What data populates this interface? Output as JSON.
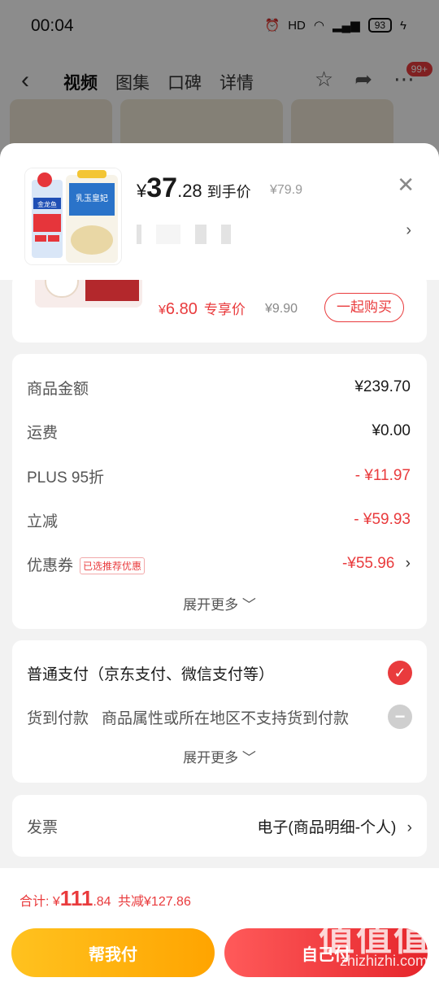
{
  "status_bar": {
    "time": "00:04",
    "battery": "93"
  },
  "nav": {
    "back": "‹",
    "tabs": [
      "视频",
      "图集",
      "口碑",
      "详情"
    ],
    "badge": "99+"
  },
  "product": {
    "price_yen": "¥",
    "price_int": "37",
    "price_dec": ".28",
    "price_tag": "到手价",
    "orig_price": "¥79.9",
    "image_labels": {
      "brand": "金龙鱼",
      "name": "乳玉皇妃"
    }
  },
  "addon": {
    "price_yen": "¥",
    "price_num": "6.80",
    "price_tag": "专享价",
    "orig_price": "¥9.90",
    "button": "一起购买"
  },
  "summary": {
    "rows": [
      {
        "label": "商品金额",
        "value": "¥239.70"
      },
      {
        "label": "运费",
        "value": "¥0.00"
      },
      {
        "label": "PLUS 95折",
        "value": "- ¥11.97"
      },
      {
        "label": "立减",
        "value": "- ¥59.93"
      },
      {
        "label": "优惠券",
        "value": "-¥55.96",
        "tag": "已选推荐优惠"
      }
    ],
    "expand": "展开更多"
  },
  "payment": {
    "normal": "普通支付（京东支付、微信支付等）",
    "cod_label": "货到付款",
    "cod_note": "商品属性或所在地区不支持货到付款",
    "expand": "展开更多"
  },
  "invoice": {
    "label": "发票",
    "value": "电子(商品明细-个人)"
  },
  "footer": {
    "total_label": "合计: ¥",
    "total_int": "111",
    "total_dec": ".84",
    "saved": "共减¥127.86",
    "help_button": "帮我付",
    "self_button": "自己付"
  },
  "watermark": {
    "main": "值值值",
    "sub": "zhizhizhi.com"
  },
  "colors": {
    "accent": "#e93b3d",
    "yellow": "#ffb300"
  }
}
